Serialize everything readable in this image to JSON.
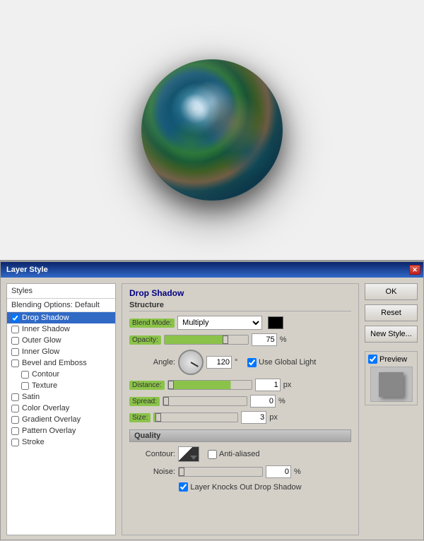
{
  "canvas": {
    "background": "#f0f0f0"
  },
  "dialog": {
    "title": "Layer Style",
    "close_button": "✕",
    "left_panel": {
      "header": "Styles",
      "items": [
        {
          "id": "blending-options",
          "label": "Blending Options: Default",
          "type": "header",
          "checked": false
        },
        {
          "id": "drop-shadow",
          "label": "Drop Shadow",
          "type": "checkbox",
          "checked": true,
          "selected": true
        },
        {
          "id": "inner-shadow",
          "label": "Inner Shadow",
          "type": "checkbox",
          "checked": false
        },
        {
          "id": "outer-glow",
          "label": "Outer Glow",
          "type": "checkbox",
          "checked": false
        },
        {
          "id": "inner-glow",
          "label": "Inner Glow",
          "type": "checkbox",
          "checked": false
        },
        {
          "id": "bevel-emboss",
          "label": "Bevel and Emboss",
          "type": "checkbox",
          "checked": false
        },
        {
          "id": "contour",
          "label": "Contour",
          "type": "checkbox",
          "checked": false,
          "sub": true
        },
        {
          "id": "texture",
          "label": "Texture",
          "type": "checkbox",
          "checked": false,
          "sub": true
        },
        {
          "id": "satin",
          "label": "Satin",
          "type": "checkbox",
          "checked": false
        },
        {
          "id": "color-overlay",
          "label": "Color Overlay",
          "type": "checkbox",
          "checked": false
        },
        {
          "id": "gradient-overlay",
          "label": "Gradient Overlay",
          "type": "checkbox",
          "checked": false
        },
        {
          "id": "pattern-overlay",
          "label": "Pattern Overlay",
          "type": "checkbox",
          "checked": false
        },
        {
          "id": "stroke",
          "label": "Stroke",
          "type": "checkbox",
          "checked": false
        }
      ]
    },
    "main_section": {
      "title": "Drop Shadow",
      "structure_title": "Structure",
      "blend_mode_label": "Blend Mode:",
      "blend_mode_value": "Multiply",
      "opacity_label": "Opacity:",
      "opacity_value": "75",
      "opacity_unit": "%",
      "angle_label": "Angle:",
      "angle_value": "120",
      "angle_unit": "°",
      "use_global_light_label": "Use Global Light",
      "distance_label": "Distance:",
      "distance_value": "1",
      "distance_unit": "px",
      "spread_label": "Spread:",
      "spread_value": "0",
      "spread_unit": "%",
      "size_label": "Size:",
      "size_value": "3",
      "size_unit": "px",
      "quality_title": "Quality",
      "contour_label": "Contour:",
      "anti_aliased_label": "Anti-aliased",
      "noise_label": "Noise:",
      "noise_value": "0",
      "noise_unit": "%",
      "layer_knocks_label": "Layer Knocks Out Drop Shadow"
    },
    "action_buttons": {
      "ok": "OK",
      "reset": "Reset",
      "new_style": "New Style...",
      "preview": "Preview"
    }
  }
}
